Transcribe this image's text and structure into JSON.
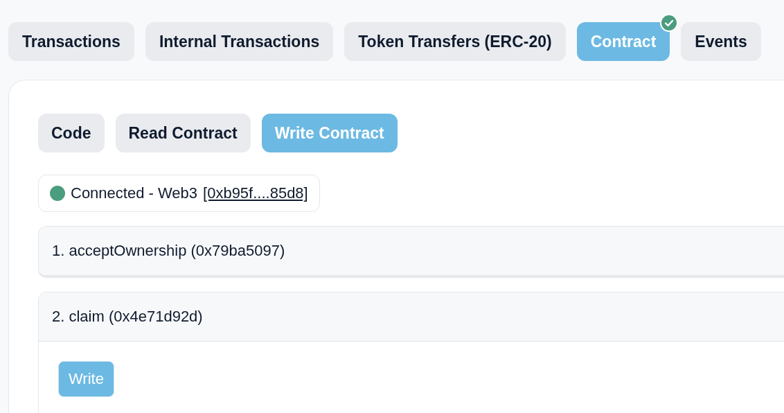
{
  "tabs": [
    {
      "label": "Transactions",
      "selected": false,
      "verified": false
    },
    {
      "label": "Internal Transactions",
      "selected": false,
      "verified": false
    },
    {
      "label": "Token Transfers (ERC-20)",
      "selected": false,
      "verified": false
    },
    {
      "label": "Contract",
      "selected": true,
      "verified": true
    },
    {
      "label": "Events",
      "selected": false,
      "verified": false
    }
  ],
  "subtabs": [
    {
      "label": "Code",
      "selected": false
    },
    {
      "label": "Read Contract",
      "selected": false
    },
    {
      "label": "Write Contract",
      "selected": true
    }
  ],
  "connection": {
    "connected": true,
    "label": "Connected - Web3",
    "address": "[0xb95f....85d8]"
  },
  "functions": [
    {
      "title": "1. acceptOwnership (0x79ba5097)",
      "expanded": false
    },
    {
      "title": "2. claim (0x4e71d92d)",
      "expanded": true,
      "button": "Write"
    }
  ]
}
